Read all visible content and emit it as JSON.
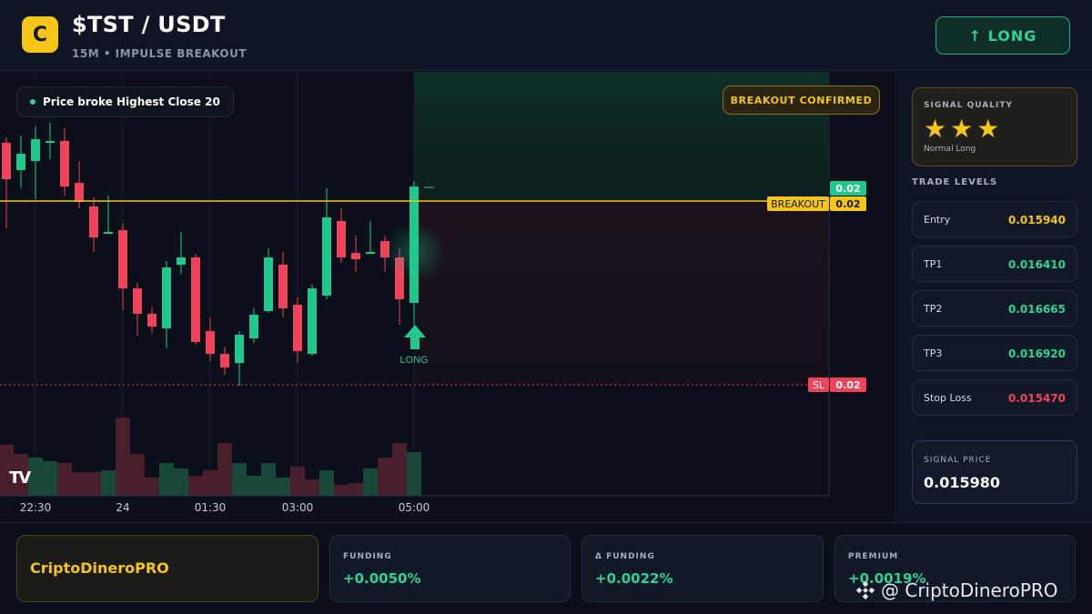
{
  "header": {
    "logo_letter": "C",
    "pair": "$TST / USDT",
    "subtitle": "15M • IMPULSE BREAKOUT",
    "long_button": "↑ LONG"
  },
  "chart": {
    "info_pill": "Price broke Highest Close 20",
    "breakout_badge": "BREAKOUT CONFIRMED",
    "tv_logo": "TV",
    "long_marker_label": "LONG",
    "time_labels": [
      "22:30",
      "24",
      "01:30",
      "03:00",
      "05:00"
    ],
    "price_tags": {
      "current": "0.02",
      "breakout_label": "BREAKOUT",
      "breakout_value": "0.02",
      "sl_label": "SL",
      "sl_value": "0.02"
    },
    "colors": {
      "up": "#22c78b",
      "down": "#f0435a",
      "breakout_line": "#f5c51a",
      "sl_line": "#f0435a"
    }
  },
  "sidebar": {
    "signal_quality_title": "SIGNAL QUALITY",
    "stars": "★★★",
    "star_count": 3,
    "signal_quality_label": "Normal Long",
    "trade_levels_title": "TRADE LEVELS",
    "levels": [
      {
        "label": "Entry",
        "value": "0.015940",
        "color": "#f5c51a"
      },
      {
        "label": "TP1",
        "value": "0.016410",
        "color": "#2fd394"
      },
      {
        "label": "TP2",
        "value": "0.016665",
        "color": "#2fd394"
      },
      {
        "label": "TP3",
        "value": "0.016920",
        "color": "#2fd394"
      },
      {
        "label": "Stop Loss",
        "value": "0.015470",
        "color": "#f0435a"
      }
    ],
    "signal_price_label": "SIGNAL PRICE",
    "signal_price_value": "0.015980"
  },
  "bottom": {
    "brand": "CriptoDineroPRO",
    "stats": [
      {
        "label": "FUNDING",
        "value": "+0.0050%"
      },
      {
        "label": "Δ FUNDING",
        "value": "+0.0022%"
      },
      {
        "label": "PREMIUM",
        "value": "+0.0019%"
      }
    ],
    "watermark": "@ CriptoDineroPRO"
  }
}
